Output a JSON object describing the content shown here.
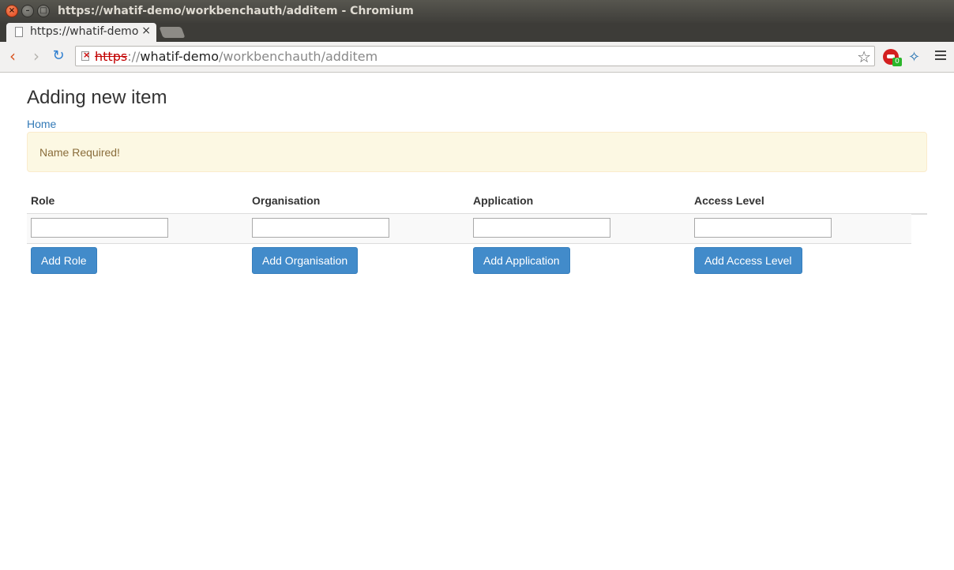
{
  "window": {
    "title": "https://whatif-demo/workbenchauth/additem - Chromium"
  },
  "tab": {
    "title": "https://whatif-demo",
    "close": "×"
  },
  "toolbar": {
    "back_icon": "back-arrow-icon",
    "forward_icon": "forward-arrow-icon",
    "reload_icon": "reload-icon",
    "url_scheme": "https",
    "url_sep": "://",
    "url_host": "whatif-demo",
    "url_path": "/workbenchauth/additem",
    "extension_badge": "0"
  },
  "page": {
    "heading": "Adding new item",
    "home_link": "Home",
    "alert": "Name Required!",
    "alert_color": "#fcf8e3"
  },
  "table": {
    "columns": [
      "Role",
      "Organisation",
      "Application",
      "Access Level"
    ],
    "inputs": [
      "",
      "",
      "",
      ""
    ],
    "buttons": [
      "Add Role",
      "Add Organisation",
      "Add Application",
      "Add Access Level"
    ]
  },
  "colors": {
    "primary_button": "#428bca",
    "link": "#337ab7"
  }
}
